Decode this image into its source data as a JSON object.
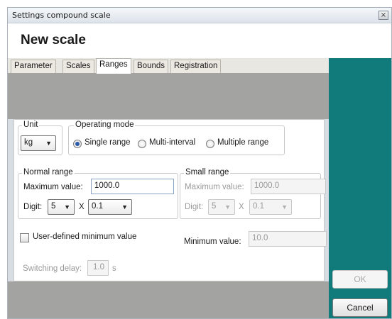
{
  "window": {
    "title": "Settings compound scale",
    "close_icon": "close-icon"
  },
  "header": {
    "scale_title": "New scale"
  },
  "tabs": [
    {
      "label": "Parameter",
      "active": false
    },
    {
      "label": "Scales",
      "active": false
    },
    {
      "label": "Ranges",
      "active": true
    },
    {
      "label": "Bounds",
      "active": false
    },
    {
      "label": "Registration",
      "active": false
    }
  ],
  "unit": {
    "legend": "Unit",
    "value": "kg"
  },
  "operating_mode": {
    "legend": "Operating mode",
    "options": [
      {
        "label": "Single range",
        "checked": true
      },
      {
        "label": "Multi-interval",
        "checked": false
      },
      {
        "label": "Multiple range",
        "checked": false
      }
    ]
  },
  "normal_range": {
    "legend": "Normal range",
    "max_label": "Maximum value:",
    "max_value": "1000.0",
    "digit_label": "Digit:",
    "digit_value": "5",
    "times": "X",
    "step_value": "0.1"
  },
  "small_range": {
    "legend": "Small range",
    "max_label": "Maximum value:",
    "max_value": "1000.0",
    "digit_label": "Digit:",
    "digit_value": "5",
    "times": "X",
    "step_value": "0.1"
  },
  "user_min": {
    "label": "User-defined minimum value",
    "checked": false
  },
  "minimum": {
    "label": "Minimum value:",
    "value": "10.0"
  },
  "switching": {
    "label": "Switching delay:",
    "value": "1.0",
    "unit": "s"
  },
  "buttons": {
    "ok": "OK",
    "cancel": "Cancel"
  },
  "colors": {
    "accent": "#117a7a",
    "content_bg": "#a3a4a1",
    "window_bg": "#d7dde3"
  }
}
